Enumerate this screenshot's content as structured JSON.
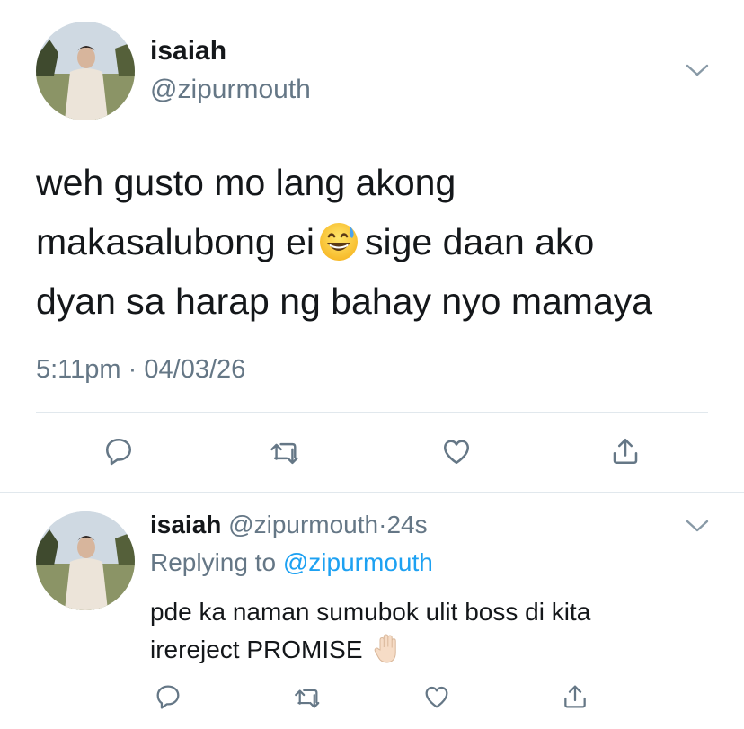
{
  "main_tweet": {
    "author_name": "isaiah",
    "author_handle": "@zipurmouth",
    "text_line1": "weh gusto mo lang akong",
    "text_line2_before": "makasalubong ei",
    "text_line2_emoji": "grinning-sweat-emoji",
    "text_line2_after": "sige daan ako",
    "text_line3": "dyan sa harap ng bahay nyo mamaya",
    "time": "5:11pm",
    "separator": "·",
    "date": "04/03/26",
    "actions": [
      "reply-icon",
      "retweet-icon",
      "like-icon",
      "share-icon"
    ]
  },
  "reply_tweet": {
    "author_name": "isaiah",
    "author_handle": "@zipurmouth",
    "separator": "·",
    "age": "24s",
    "replying_prefix": "Replying to",
    "replying_handle": "@zipurmouth",
    "text_line1": "pde ka naman sumubok ulit boss di kita",
    "text_line2": "irereject PROMISE",
    "text_emoji": "raised-hand-emoji",
    "actions": [
      "reply-icon",
      "retweet-icon",
      "like-icon",
      "share-icon"
    ]
  },
  "colors": {
    "text_primary": "#14171a",
    "text_secondary": "#657786",
    "link": "#1da1f2",
    "divider": "#e1e8ed"
  }
}
